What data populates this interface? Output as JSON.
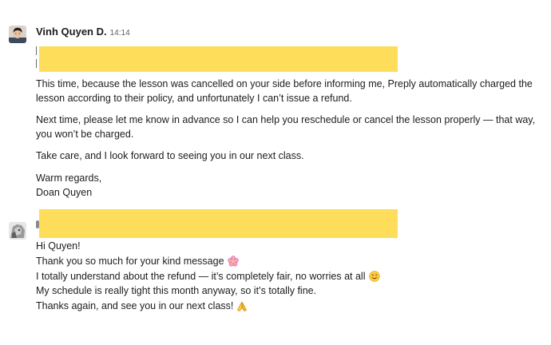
{
  "message1": {
    "sender": "Vinh Quyen D.",
    "timestamp": "14:14",
    "paragraphs": [
      "This time, because the lesson was cancelled on your side before informing me, Preply automatically charged the lesson according to their policy, and unfortunately I can’t issue a refund.",
      "Next time, please let me know in advance so I can help you reschedule or cancel the lesson properly — that way, you won’t be charged.",
      "Take care, and I look forward to seeing you in our next class."
    ],
    "signoff": "Warm regards,",
    "signature": "Doan Quyen"
  },
  "message2": {
    "lines": [
      "Hi Quyen!",
      "Thank you so much for your kind message",
      "I totally understand about the refund — it’s completely fair, no worries at all",
      "My schedule is really tight this month anyway, so it’s totally fine.",
      "Thanks again, and see you in our next class!"
    ],
    "emojis": [
      "cherry-blossom-icon",
      "smiling-face-icon",
      "folded-hands-icon"
    ]
  },
  "colors": {
    "redaction": "#fedd5a",
    "text": "#1d1c1d",
    "timestamp": "#616061"
  }
}
